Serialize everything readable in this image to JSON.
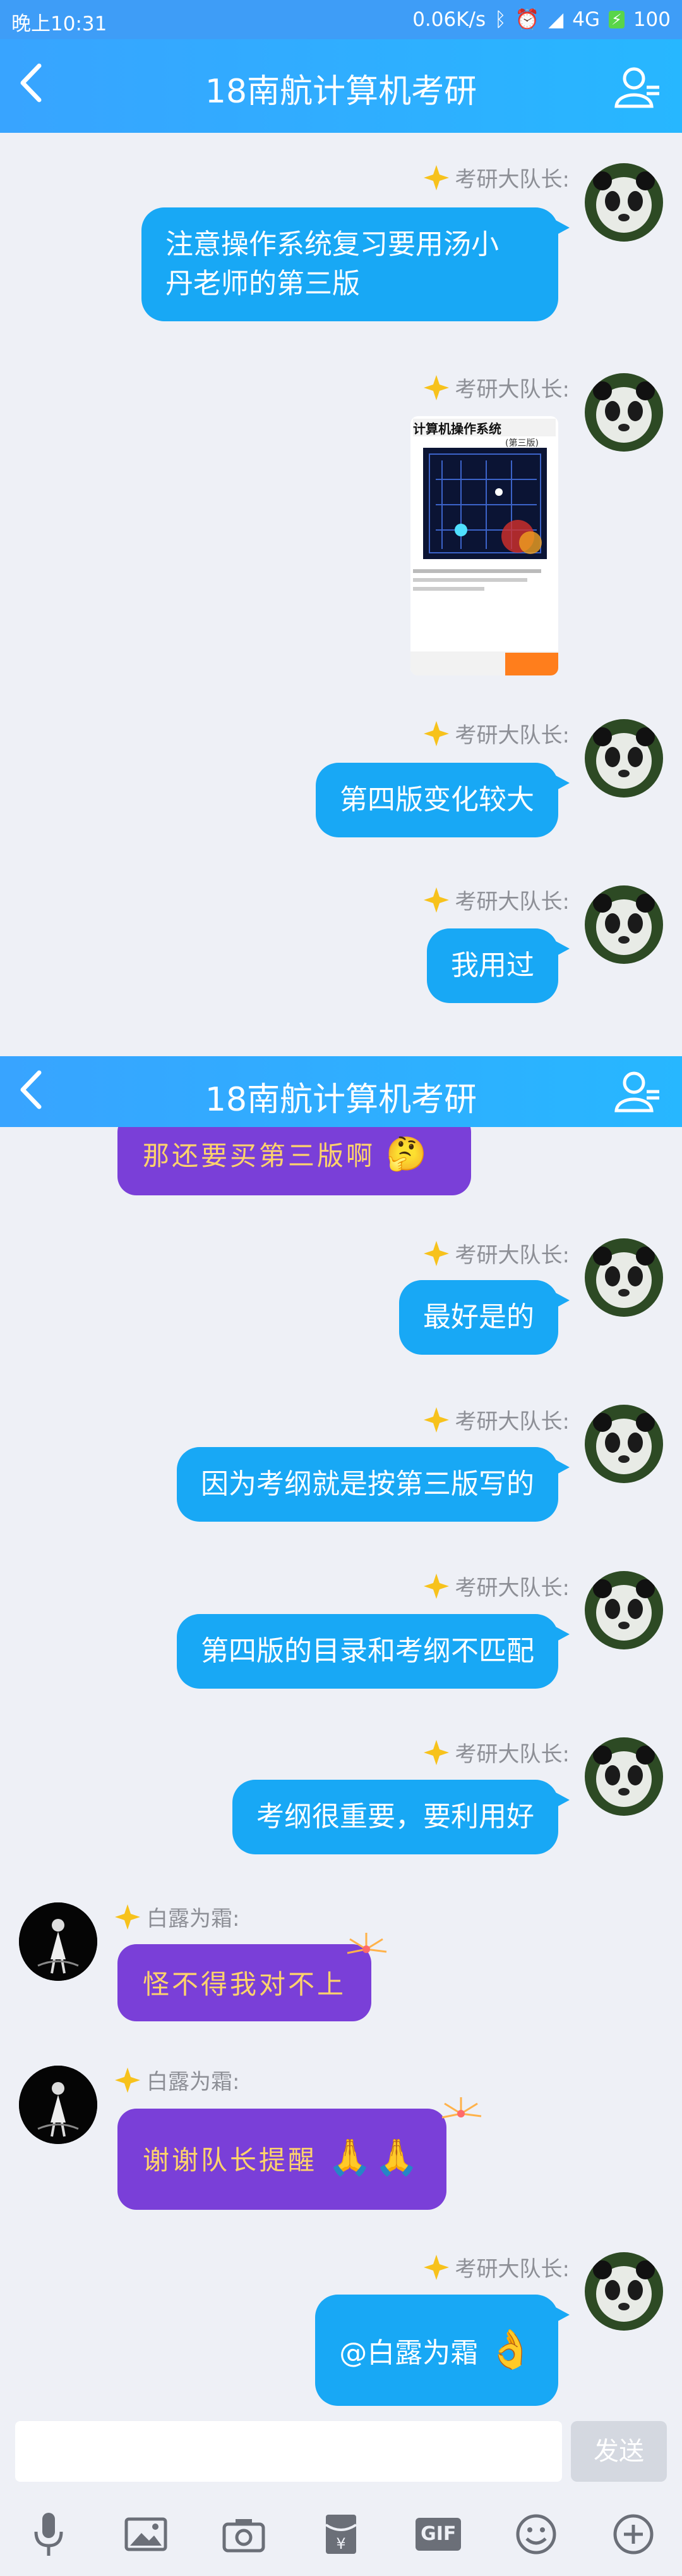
{
  "status": {
    "time": "晚上10:31",
    "speed": "0.06K/s",
    "network": "4G",
    "battery": "100"
  },
  "header": {
    "title": "18南航计算机考研"
  },
  "header2": {
    "title": "18南航计算机考研"
  },
  "messages": [
    {
      "sender": "考研大队长:",
      "text_line1": "注意操作系统复习要用汤小",
      "text_line2": "丹老师的第三版"
    },
    {
      "sender": "考研大队长:",
      "book_title": "计算机操作系统",
      "book_edition": "(第三版)"
    },
    {
      "sender": "考研大队长:",
      "text": "第四版变化较大"
    },
    {
      "sender": "考研大队长:",
      "text": "我用过"
    },
    {
      "partial_text": "那还要买第三版啊"
    },
    {
      "sender": "考研大队长:",
      "text": "最好是的"
    },
    {
      "sender": "考研大队长:",
      "text": "因为考纲就是按第三版写的"
    },
    {
      "sender": "考研大队长:",
      "text": "第四版的目录和考纲不匹配"
    },
    {
      "sender": "考研大队长:",
      "text": "考纲很重要，要利用好"
    },
    {
      "sender": "白露为霜:",
      "text": "怪不得我对不上"
    },
    {
      "sender": "白露为霜:",
      "text": "谢谢队长提醒"
    },
    {
      "sender": "考研大队长:",
      "text": "@白露为霜"
    }
  ],
  "input": {
    "send_label": "发送"
  },
  "toolbar": {
    "gif_label": "GIF",
    "icons": [
      "microphone-icon",
      "image-icon",
      "camera-icon",
      "red-packet-icon",
      "gif-icon",
      "emoji-icon",
      "plus-icon"
    ]
  },
  "colors": {
    "header": "#2aaeff",
    "bubble_blue": "#18a8f5",
    "bubble_purple": "#7a3fd8",
    "bubble_purple_text": "#ffd36b",
    "background": "#eef0f6"
  }
}
